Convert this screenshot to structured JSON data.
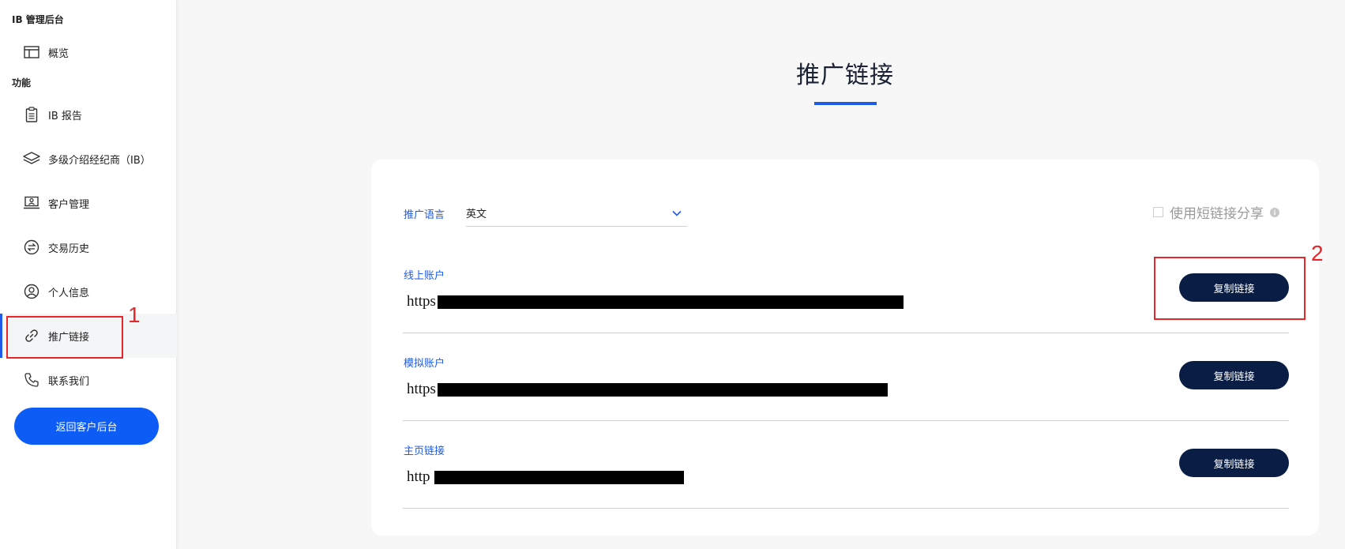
{
  "sidebar": {
    "section_admin": "IB 管理后台",
    "section_features": "功能",
    "items": [
      {
        "label": "概览",
        "icon": "layout-icon"
      },
      {
        "label": "IB 报告",
        "icon": "clipboard-icon"
      },
      {
        "label": "多级介绍经纪商（IB）",
        "icon": "layers-icon"
      },
      {
        "label": "客户管理",
        "icon": "laptop-user-icon"
      },
      {
        "label": "交易历史",
        "icon": "exchange-icon"
      },
      {
        "label": "个人信息",
        "icon": "user-circle-icon"
      },
      {
        "label": "推广链接",
        "icon": "link-icon"
      },
      {
        "label": "联系我们",
        "icon": "phone-icon"
      }
    ],
    "active_item": "推广链接",
    "back_button": "返回客户后台"
  },
  "annotations": {
    "marker_1": "1",
    "marker_2": "2"
  },
  "main": {
    "title": "推广链接",
    "language_label": "推广语言",
    "language_value": "英文",
    "short_link_label": "使用短链接分享",
    "short_link_checked": false,
    "links": [
      {
        "label": "线上账户",
        "url_prefix": "https",
        "button": "复制链接"
      },
      {
        "label": "模拟账户",
        "url_prefix": "https",
        "button": "复制链接"
      },
      {
        "label": "主页链接",
        "url_prefix": "http",
        "button": "复制链接"
      }
    ]
  },
  "colors": {
    "accent": "#1e5be6",
    "primary_button": "#0d5cf6",
    "copy_button": "#0a1e45",
    "annotation": "#e8262a"
  }
}
